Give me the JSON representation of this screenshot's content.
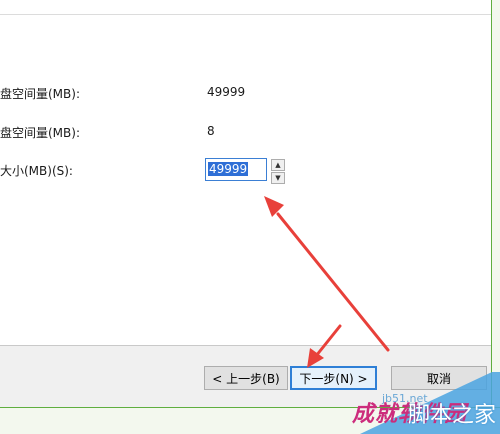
{
  "fields": [
    {
      "label": "盘空间量(MB):",
      "value": "49999"
    },
    {
      "label": "盘空间量(MB):",
      "value": "8"
    }
  ],
  "size_field": {
    "label": "大小(MB)(S):",
    "value": "49999",
    "up_glyph": "▲",
    "down_glyph": "▼"
  },
  "buttons": {
    "back": "< 上一步(B)",
    "next": "下一步(N) >",
    "cancel": "取消"
  },
  "watermark": {
    "site": "jb51.net",
    "brand": "脚本之家",
    "overlay": "成就软件园"
  },
  "colors": {
    "arrow": "#e8403a",
    "focus_blue": "#2e7fd6",
    "frame_green": "#5fae3f"
  }
}
